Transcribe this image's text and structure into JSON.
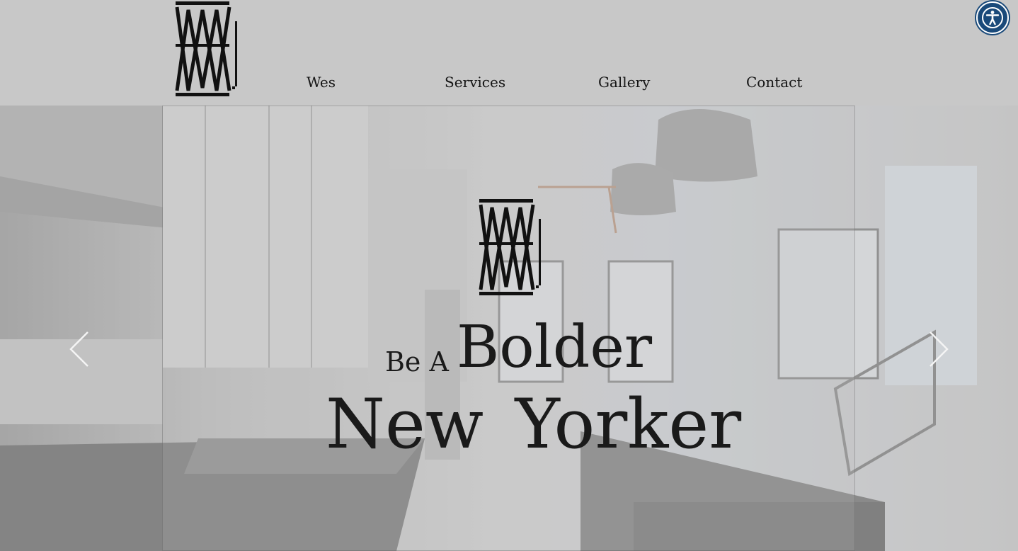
{
  "header": {
    "logo_alt": "W logo",
    "nav": [
      {
        "label": "Wes"
      },
      {
        "label": "Services"
      },
      {
        "label": "Gallery"
      },
      {
        "label": "Contact"
      }
    ],
    "accessibility_icon": "accessibility-icon"
  },
  "hero": {
    "tagline_small": "Be A",
    "tagline_big": "Bolder",
    "tagline_line2": "New Yorker",
    "prev_icon": "chevron-left-icon",
    "next_icon": "chevron-right-icon"
  },
  "colors": {
    "header_bg": "#c8c8c8",
    "text": "#1a1a1a",
    "a11y_bg": "#1a4a7a"
  }
}
